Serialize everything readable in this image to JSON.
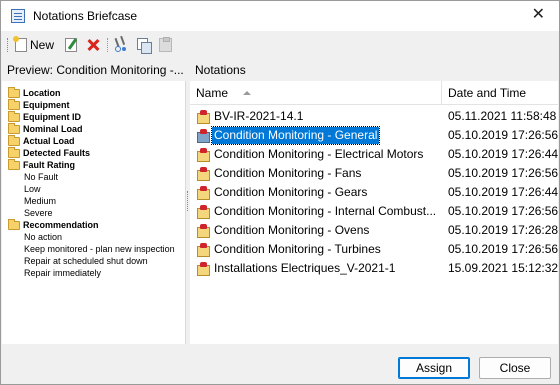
{
  "window": {
    "title": "Notations Briefcase",
    "close_label": "✕"
  },
  "toolbar": {
    "new_label": "New",
    "items": [
      "new-icon",
      "edit-icon",
      "delete-icon",
      "cut-icon",
      "copy-icon",
      "paste-icon"
    ]
  },
  "left_panel": {
    "header": "Preview: Condition Monitoring -...",
    "tree": [
      {
        "label": "Location",
        "type": "category"
      },
      {
        "label": "Equipment",
        "type": "category"
      },
      {
        "label": "Equipment ID",
        "type": "category"
      },
      {
        "label": "Nominal Load",
        "type": "category"
      },
      {
        "label": "Actual Load",
        "type": "category"
      },
      {
        "label": "Detected Faults",
        "type": "category"
      },
      {
        "label": "Fault Rating",
        "type": "category"
      },
      {
        "label": "No Fault",
        "type": "option"
      },
      {
        "label": "Low",
        "type": "option"
      },
      {
        "label": "Medium",
        "type": "option"
      },
      {
        "label": "Severe",
        "type": "option"
      },
      {
        "label": "Recommendation",
        "type": "category"
      },
      {
        "label": "No action",
        "type": "option"
      },
      {
        "label": "Keep monitored - plan new inspection",
        "type": "option"
      },
      {
        "label": "Repair at scheduled shut down",
        "type": "option"
      },
      {
        "label": "Repair immediately",
        "type": "option"
      }
    ]
  },
  "right_panel": {
    "header": "Notations",
    "columns": {
      "name": "Name",
      "date": "Date and Time"
    },
    "rows": [
      {
        "name": "BV-IR-2021-14.1",
        "date": "05.11.2021 11:58:48",
        "selected": false
      },
      {
        "name": "Condition Monitoring -  General",
        "date": "05.10.2019 17:26:56",
        "selected": true
      },
      {
        "name": "Condition Monitoring - Electrical Motors",
        "date": "05.10.2019 17:26:44",
        "selected": false
      },
      {
        "name": "Condition Monitoring - Fans",
        "date": "05.10.2019 17:26:56",
        "selected": false
      },
      {
        "name": "Condition Monitoring - Gears",
        "date": "05.10.2019 17:26:44",
        "selected": false
      },
      {
        "name": "Condition Monitoring - Internal Combust...",
        "date": "05.10.2019 17:26:56",
        "selected": false
      },
      {
        "name": "Condition Monitoring - Ovens",
        "date": "05.10.2019 17:26:28",
        "selected": false
      },
      {
        "name": "Condition Monitoring - Turbines",
        "date": "05.10.2019 17:26:56",
        "selected": false
      },
      {
        "name": "Installations Electriques_V-2021-1",
        "date": "15.09.2021 15:12:32",
        "selected": false
      }
    ]
  },
  "buttons": {
    "assign": "Assign",
    "close": "Close"
  },
  "colors": {
    "selection": "#0078d7",
    "window_bg": "#f0f0f0"
  }
}
